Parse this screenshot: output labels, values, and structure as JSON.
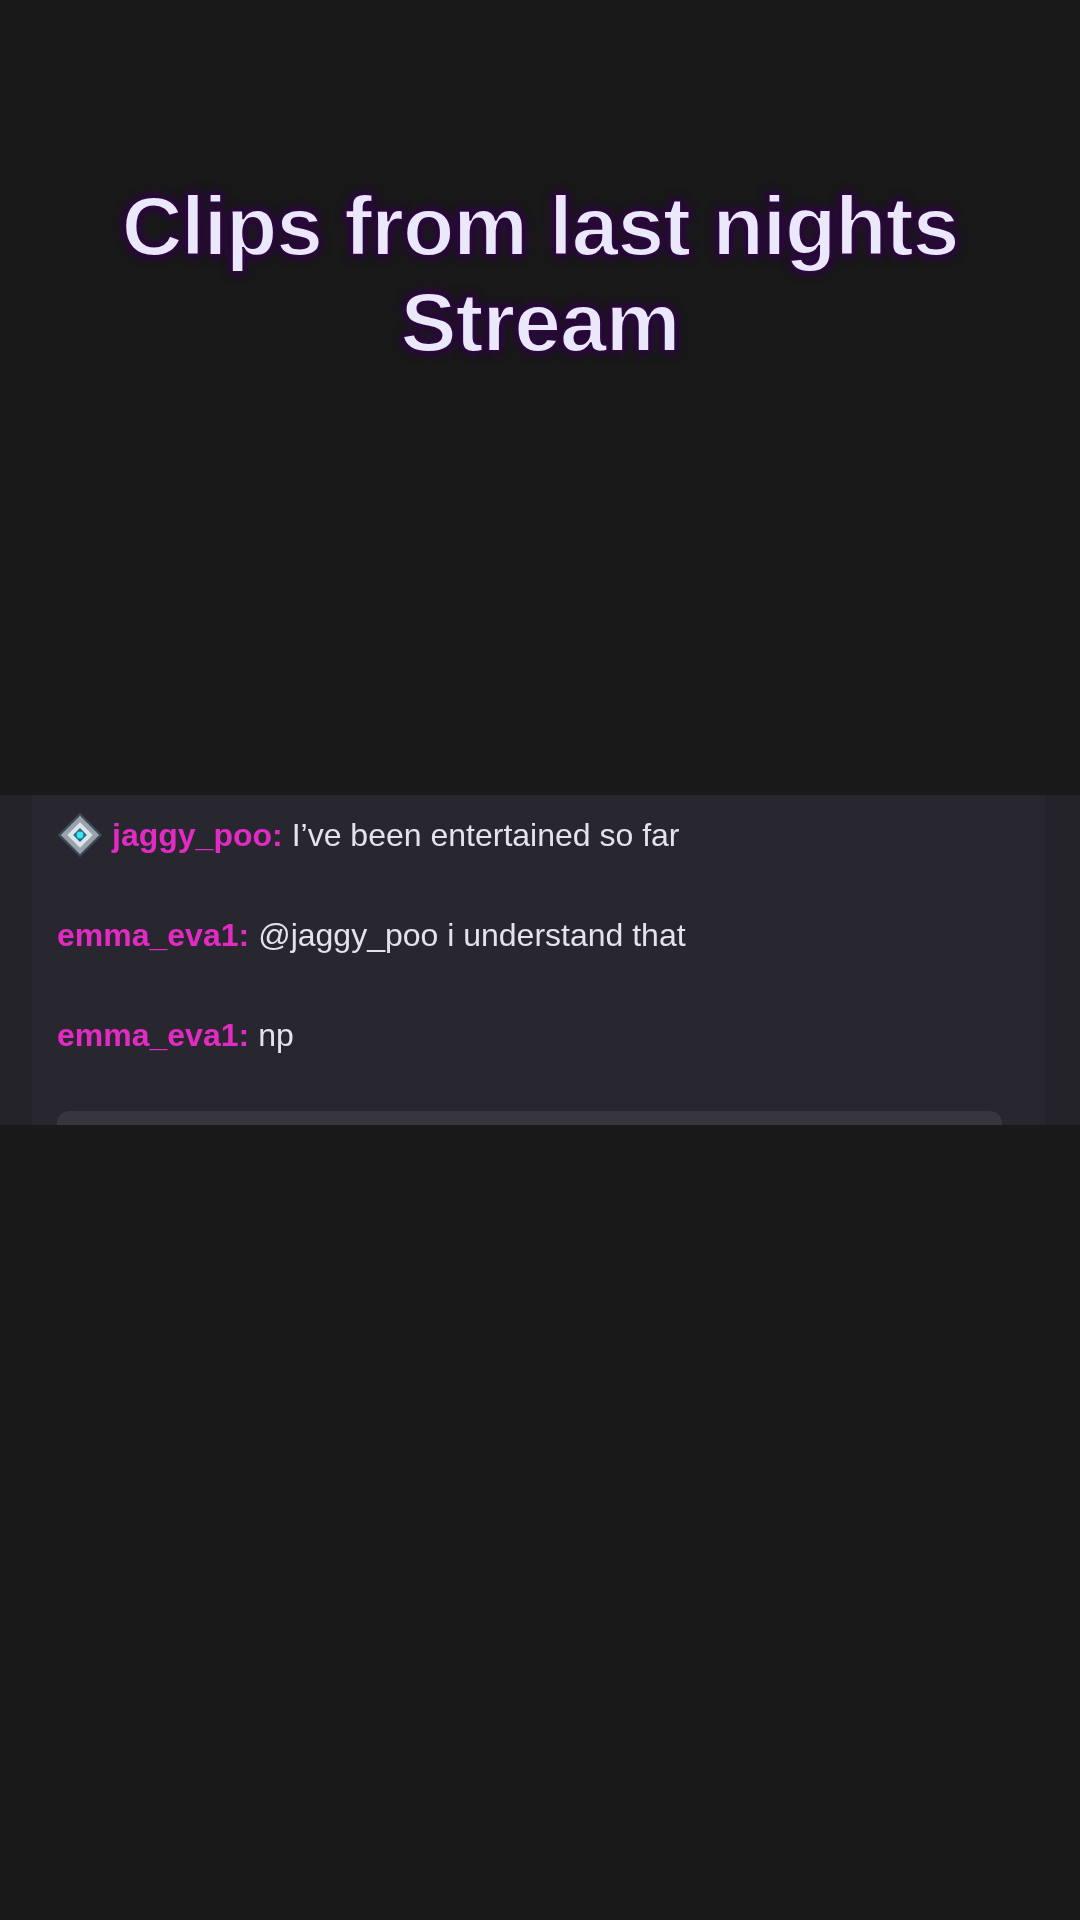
{
  "title": {
    "lines": [
      "Clips from last nights",
      "Stream"
    ]
  },
  "chat": {
    "messages": [
      {
        "badge": true,
        "user": "jaggy_poo:",
        "text": "I’ve been entertained so far"
      },
      {
        "badge": false,
        "user": "emma_eva1:",
        "text": "@jaggy_poo i understand that"
      },
      {
        "badge": false,
        "user": "emma_eva1:",
        "text": "np"
      }
    ]
  }
}
